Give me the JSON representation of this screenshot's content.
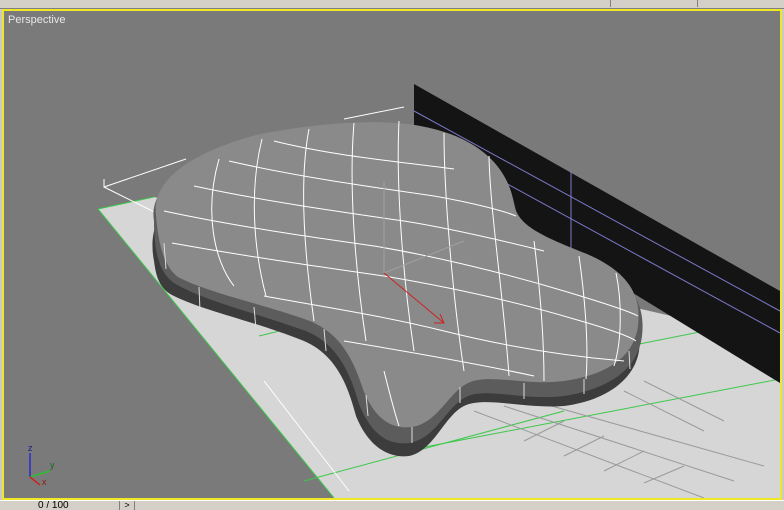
{
  "viewport": {
    "label": "Perspective",
    "border_color": "#f0e826",
    "background": "#7a7a7a"
  },
  "axis_tripod": {
    "x_label": "x",
    "y_label": "y",
    "z_label": "z"
  },
  "time_slider": {
    "frame_text": "0 / 100",
    "arrow": ">"
  },
  "colors": {
    "grid_green": "#3cc84a",
    "object_fill": "#8a8a8a",
    "wire": "#ffffff",
    "panel_black": "#141414"
  }
}
